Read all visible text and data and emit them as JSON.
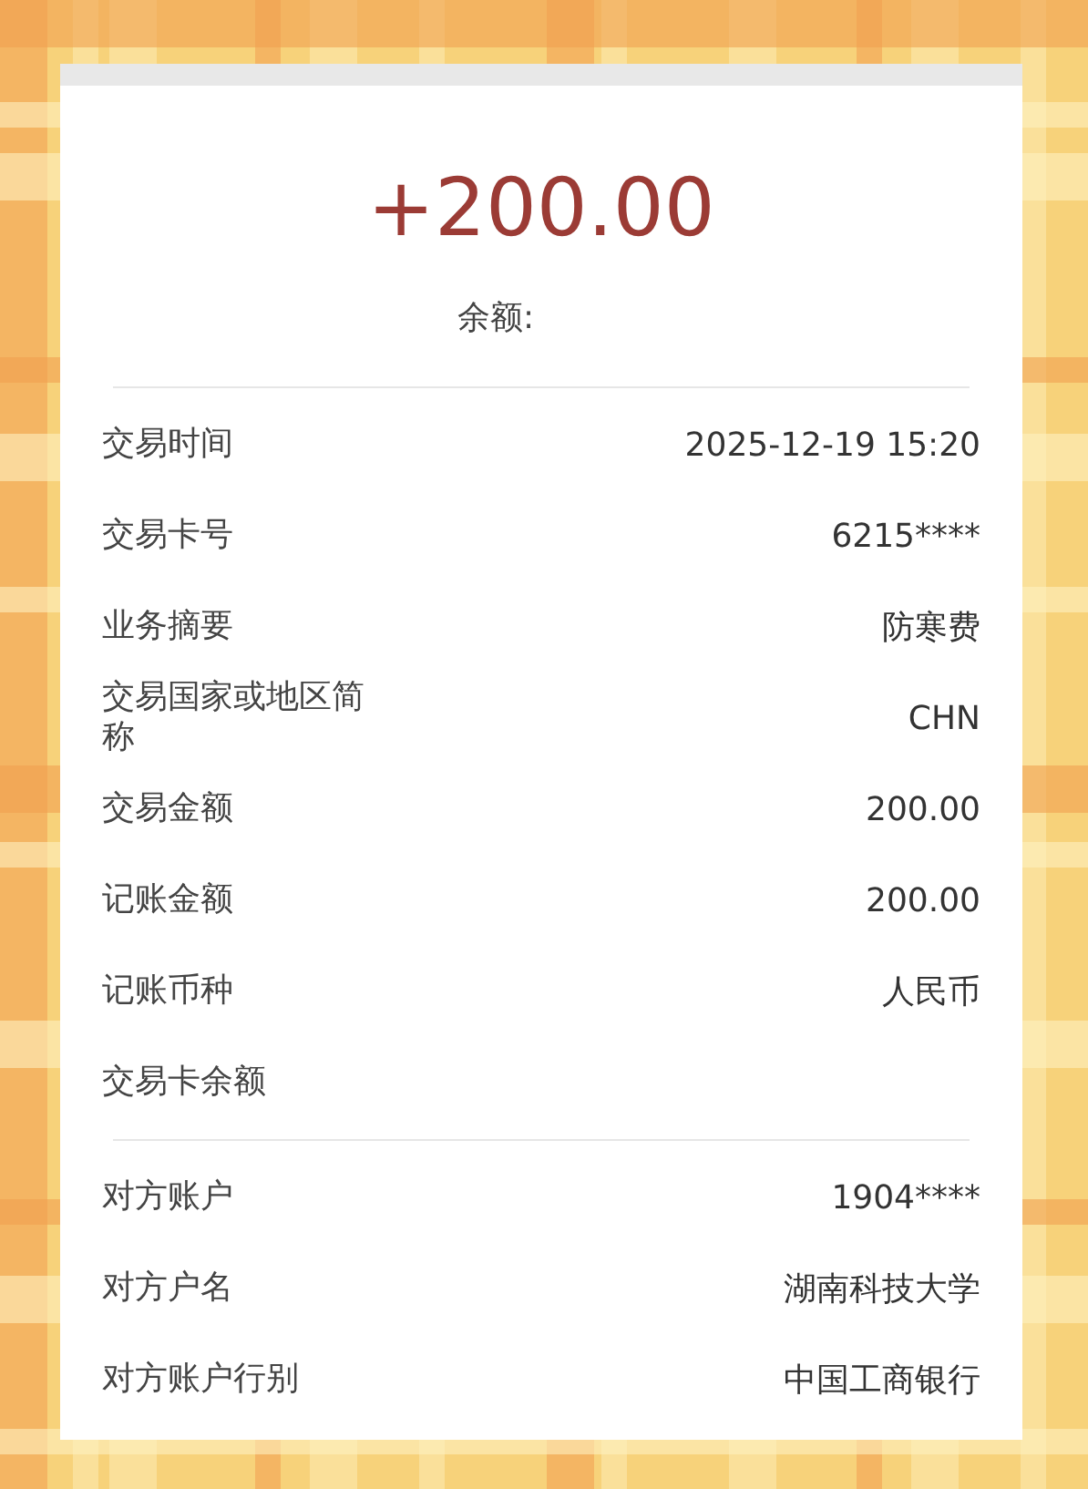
{
  "amount": "+200.00",
  "balance_label": "余额:",
  "sections": [
    {
      "rows": [
        {
          "label": "交易时间",
          "value": "2025-12-19 15:20"
        },
        {
          "label": "交易卡号",
          "value": "6215****"
        },
        {
          "label": "业务摘要",
          "value": "防寒费"
        },
        {
          "label": "交易国家或地区简称",
          "value": "CHN"
        },
        {
          "label": "交易金额",
          "value": "200.00"
        },
        {
          "label": "记账金额",
          "value": "200.00"
        },
        {
          "label": "记账币种",
          "value": "人民币"
        },
        {
          "label": "交易卡余额"
        }
      ]
    },
    {
      "rows": [
        {
          "label": "对方账户",
          "value": "1904****"
        },
        {
          "label": "对方户名",
          "value": "湖南科技大学"
        },
        {
          "label": "对方账户行别",
          "value": "中国工商银行"
        }
      ]
    }
  ]
}
